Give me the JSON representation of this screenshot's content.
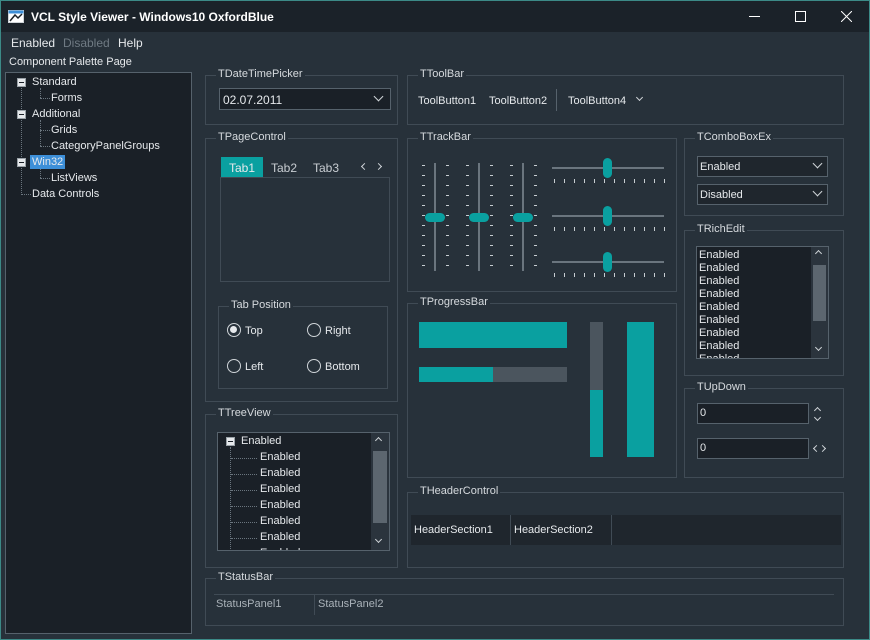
{
  "window": {
    "title": "VCL Style Viewer - Windows10 OxfordBlue"
  },
  "menu": [
    "Enabled",
    "Disabled",
    "Help"
  ],
  "palette": {
    "caption": "Component Palette Page",
    "items": [
      {
        "label": "Standard",
        "level": 0,
        "expander": true
      },
      {
        "label": "Forms",
        "level": 1
      },
      {
        "label": "Additional",
        "level": 0,
        "expander": true
      },
      {
        "label": "Grids",
        "level": 1
      },
      {
        "label": "CategoryPanelGroups",
        "level": 1
      },
      {
        "label": "Win32",
        "level": 0,
        "expander": true,
        "selected": true
      },
      {
        "label": "ListViews",
        "level": 1
      },
      {
        "label": "Data Controls",
        "level": 0
      }
    ]
  },
  "datetime": {
    "caption": "TDateTimePicker",
    "value": "02.07.2011"
  },
  "toolbar": {
    "caption": "TToolBar",
    "b1": "ToolButton1",
    "b2": "ToolButton2",
    "b4": "ToolButton4"
  },
  "pagecontrol": {
    "caption": "TPageControl",
    "tabs": [
      "Tab1",
      "Tab2",
      "Tab3"
    ]
  },
  "tabpos": {
    "caption": "Tab Position",
    "top": "Top",
    "right": "Right",
    "left": "Left",
    "bottom": "Bottom",
    "selected": "Top"
  },
  "trackbar": {
    "caption": "TTrackBar",
    "vertical_positions": [
      0.5,
      0.5,
      0.5
    ],
    "horizontal_positions": [
      0.5,
      0.5,
      0.5
    ]
  },
  "progress": {
    "caption": "TProgressBar",
    "values": [
      1.0,
      0.5,
      0.5,
      1.0
    ]
  },
  "comboex": {
    "caption": "TComboBoxEx",
    "enabled": "Enabled",
    "disabled": "Disabled"
  },
  "richedit": {
    "caption": "TRichEdit",
    "lines": [
      "Enabled",
      "Enabled",
      "Enabled",
      "Enabled",
      "Enabled",
      "Enabled",
      "Enabled",
      "Enabled",
      "Enabled"
    ]
  },
  "updown": {
    "caption": "TUpDown",
    "v1": "0",
    "v2": "0"
  },
  "treeview": {
    "caption": "TTreeView",
    "root": "Enabled",
    "children": [
      "Enabled",
      "Enabled",
      "Enabled",
      "Enabled",
      "Enabled",
      "Enabled",
      "Enabled"
    ]
  },
  "header": {
    "caption": "THeaderControl",
    "s1": "HeaderSection1",
    "s2": "HeaderSection2"
  },
  "statusbar": {
    "caption": "TStatusBar",
    "p1": "StatusPanel1",
    "p2": "StatusPanel2"
  },
  "colors": {
    "accent": "#0aa0a0",
    "background": "#27313a",
    "field": "#1a2027",
    "selection": "#3d8fd8"
  }
}
